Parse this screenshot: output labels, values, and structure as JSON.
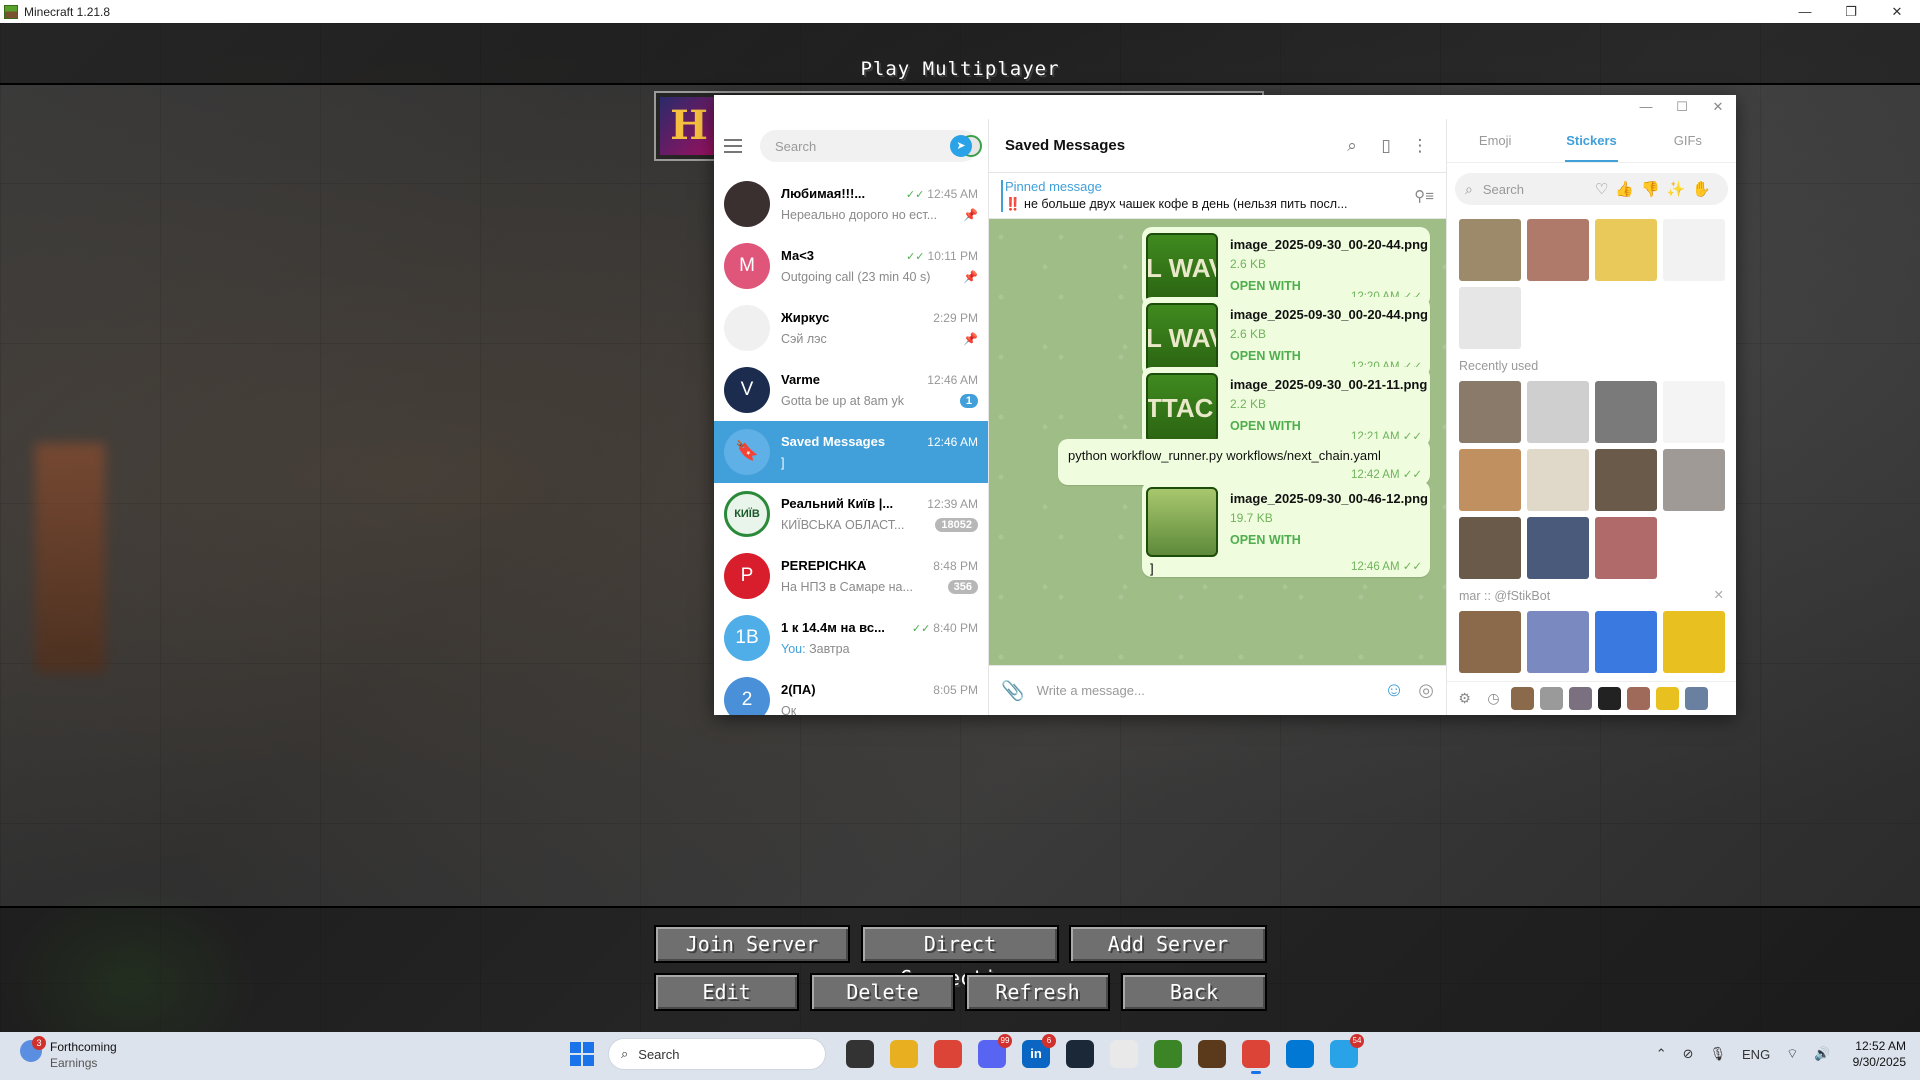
{
  "minecraft": {
    "window_title": "Minecraft 1.21.8",
    "screen_title": "Play Multiplayer",
    "server_icon_letter": "H",
    "buttons": {
      "join": "Join Server",
      "direct": "Direct Connection",
      "add": "Add Server",
      "edit": "Edit",
      "delete": "Delete",
      "refresh": "Refresh",
      "back": "Back"
    }
  },
  "telegram": {
    "search_placeholder": "Search",
    "chats": [
      {
        "name": "Любимая!!!...",
        "time": "12:45 AM",
        "preview": "Нереально дорого но ест...",
        "avatar": "",
        "avatar_color": "#3a3030",
        "read": "✓✓",
        "pinned": "📌"
      },
      {
        "name": "Ма<3",
        "time": "10:11 PM",
        "preview": "Outgoing call (23 min 40 s)",
        "avatar": "M",
        "avatar_color": "#e0557a",
        "read": "✓✓",
        "pinned": "📌"
      },
      {
        "name": "Жиркус",
        "time": "2:29 PM",
        "preview": "Сэй лэс",
        "avatar": "",
        "avatar_color": "#f0f0f0",
        "read": "",
        "pinned": "📌"
      },
      {
        "name": "Varme",
        "time": "12:46 AM",
        "preview": "Gotta be up at 8am yk",
        "avatar": "V",
        "avatar_color": "#1b2c4e",
        "badge": "1"
      },
      {
        "name": "Saved Messages",
        "time": "12:46 AM",
        "preview": "]",
        "avatar": "🔖",
        "avatar_color": "#5fb0e6"
      },
      {
        "name": "Реальний Київ |...",
        "time": "12:39 AM",
        "preview": "КИЇВСЬКА ОБЛАСТ...",
        "avatar": "КИЇВ",
        "avatar_color": "#e9f5ea",
        "badge": "18052"
      },
      {
        "name": "PEREPICHKA",
        "time": "8:48 PM",
        "preview": "На НПЗ в Самаре на...",
        "avatar": "P",
        "avatar_color": "#d81e2c",
        "badge": "356"
      },
      {
        "name": "1 к 14.4м на вс...",
        "time": "8:40 PM",
        "preview_prefix": "You:",
        "preview": "Завтра",
        "avatar": "1B",
        "avatar_color": "#4faee8",
        "read": "✓✓"
      },
      {
        "name": "2(ПА)",
        "time": "8:05 PM",
        "preview": "Ок",
        "avatar": "2",
        "avatar_color": "#4a90d9"
      }
    ],
    "chat": {
      "title": "Saved Messages",
      "pinned_label": "Pinned message",
      "pinned_text": "‼️ не больше двух чашек кофе в день (нельзя пить посл...",
      "messages": [
        {
          "type": "file",
          "thumb": "L WAV",
          "name": "image_2025-09-30_00-20-44.png",
          "size": "2.6 KB",
          "action": "OPEN WITH",
          "time": "12:20 AM"
        },
        {
          "type": "file",
          "thumb": "L WAV",
          "name": "image_2025-09-30_00-20-44.png",
          "size": "2.6 KB",
          "action": "OPEN WITH",
          "time": "12:20 AM"
        },
        {
          "type": "file",
          "thumb": "TTAC",
          "name": "image_2025-09-30_00-21-11.png",
          "size": "2.2 KB",
          "action": "OPEN WITH",
          "time": "12:21 AM"
        },
        {
          "type": "text",
          "text": "python workflow_runner.py workflows/next_chain.yaml",
          "time": "12:42 AM"
        },
        {
          "type": "file",
          "thumb": "",
          "name": "image_2025-09-30_00-46-12.png",
          "size": "19.7 KB",
          "action": "OPEN WITH",
          "caption": "]",
          "time": "12:46 AM"
        }
      ],
      "composer_placeholder": "Write a message..."
    },
    "stickers": {
      "tabs": [
        "Emoji",
        "Stickers",
        "GIFs"
      ],
      "active_tab": "Stickers",
      "search_placeholder": "Search",
      "recent_label": "Recently used",
      "pack_label": "mar :: @fStikBot",
      "favorites_colors": [
        "#9c8a6a",
        "#b07a6a",
        "#e8c95a",
        "#f2f2f2",
        "#e6e6e6"
      ],
      "recent_colors": [
        "#8a7a6a",
        "#cfcfcf",
        "#7a7a7a",
        "#f4f4f4",
        "#c09060",
        "#e0d8c8",
        "#6a5a4a",
        "#a09a96",
        "#6a5a4a",
        "#4a5a7a",
        "#b06a6a"
      ],
      "pack_colors": [
        "#8a6a4a",
        "#7a8ac0",
        "#3a7ae0",
        "#e8c020"
      ]
    }
  },
  "taskbar": {
    "weather_title": "Forthcoming",
    "weather_sub": "Earnings",
    "weather_badge": "3",
    "search_placeholder": "Search",
    "apps": [
      {
        "name": "task-view",
        "label": "",
        "color": "#333"
      },
      {
        "name": "file-explorer",
        "label": "",
        "color": "#e8b020"
      },
      {
        "name": "chrome",
        "label": "",
        "color": "#db4437"
      },
      {
        "name": "discord",
        "label": "",
        "color": "#5865f2",
        "badge": "99"
      },
      {
        "name": "linkedin",
        "label": "in",
        "color": "#0a66c2",
        "badge": "6"
      },
      {
        "name": "steam",
        "label": "",
        "color": "#1b2838"
      },
      {
        "name": "mouse-app",
        "label": "",
        "color": "#e9e9e9"
      },
      {
        "name": "minecraft-launcher",
        "label": "",
        "color": "#3b8526"
      },
      {
        "name": "minecraft",
        "label": "",
        "color": "#5a3a1a"
      },
      {
        "name": "chrome-profile",
        "label": "",
        "color": "#db4437",
        "active": true
      },
      {
        "name": "vscode",
        "label": "",
        "color": "#0078d4"
      },
      {
        "name": "telegram",
        "label": "",
        "color": "#2aa2e8",
        "badge": "54"
      }
    ],
    "lang": "ENG",
    "time": "12:52 AM",
    "date": "9/30/2025"
  }
}
